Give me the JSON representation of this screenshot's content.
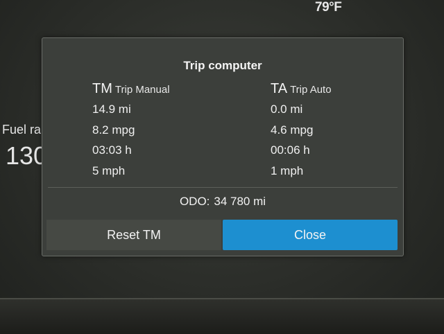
{
  "status": {
    "temperature": "79°F"
  },
  "background": {
    "fuel_label": "Fuel ra",
    "fuel_value": "130"
  },
  "dialog": {
    "title": "Trip computer",
    "trip_manual": {
      "abbr": "TM",
      "label": "Trip Manual",
      "distance": "14.9 mi",
      "economy": "8.2 mpg",
      "time": "03:03 h",
      "speed": "5 mph"
    },
    "trip_auto": {
      "abbr": "TA",
      "label": "Trip Auto",
      "distance": "0.0 mi",
      "economy": "4.6 mpg",
      "time": "00:06 h",
      "speed": "1 mph"
    },
    "odo_label": "ODO:",
    "odo_value": "34 780 mi",
    "reset_button": "Reset TM",
    "close_button": "Close"
  },
  "colors": {
    "accent": "#1d8fd0",
    "panel": "#3c3f3b"
  }
}
